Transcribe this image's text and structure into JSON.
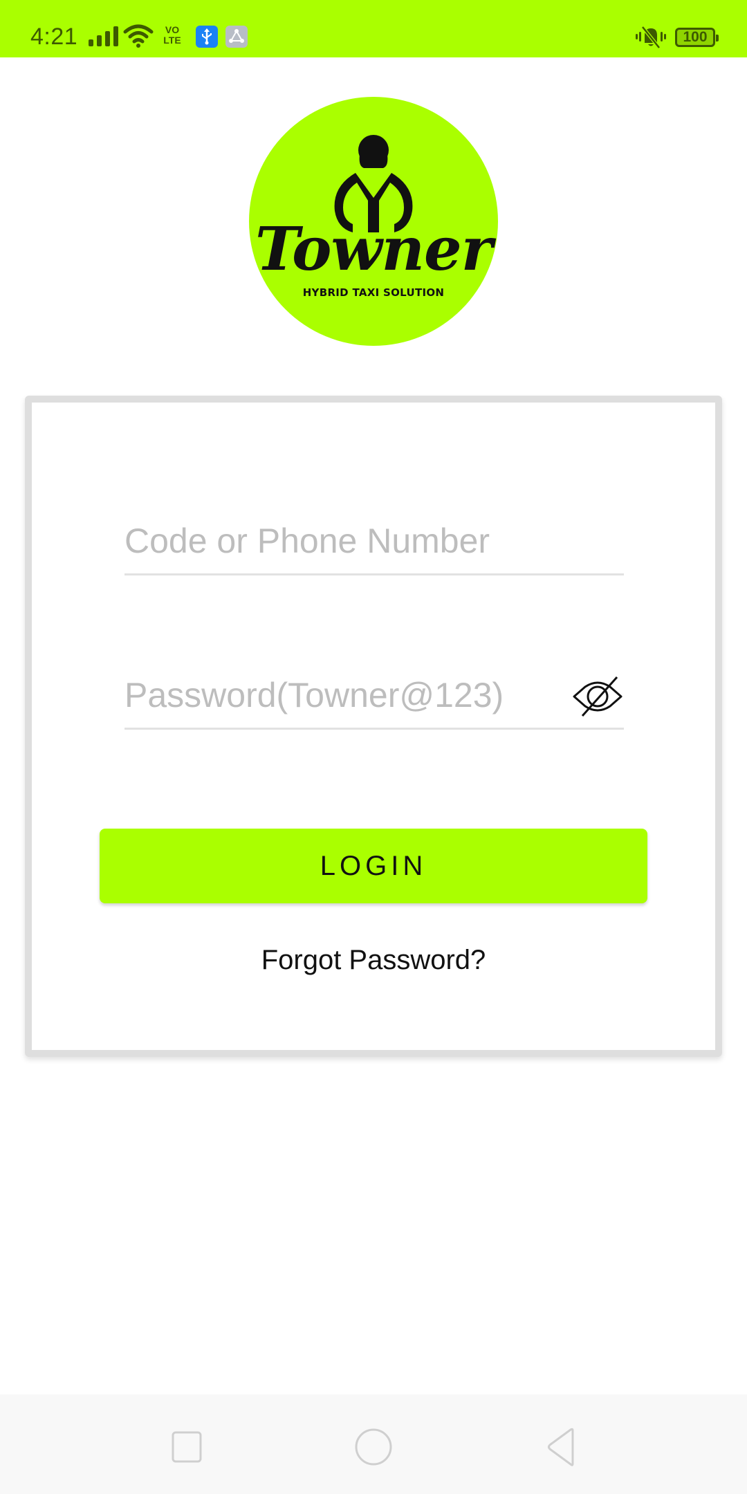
{
  "status_bar": {
    "time": "4:21",
    "network_label_top": "VO",
    "network_label_bottom": "LTE",
    "battery_level": "100",
    "icons": [
      "signal-icon",
      "wifi-icon",
      "volte-icon",
      "usb-debug-icon",
      "share-icon",
      "vibrate-mute-icon",
      "battery-icon"
    ]
  },
  "brand": {
    "name": "Towner",
    "tagline": "HYBRID TAXI SOLUTION",
    "accent_color": "#AAFF00"
  },
  "login_form": {
    "phone_field": {
      "placeholder": "Code or Phone Number",
      "value": ""
    },
    "password_field": {
      "placeholder": "Password(Towner@123)",
      "value": "",
      "visibility_icon": "eye-off-icon"
    },
    "login_label": "LOGIN",
    "forgot_password_label": "Forgot Password?"
  },
  "nav_bar": {
    "buttons": [
      "recent-apps",
      "home",
      "back"
    ]
  }
}
